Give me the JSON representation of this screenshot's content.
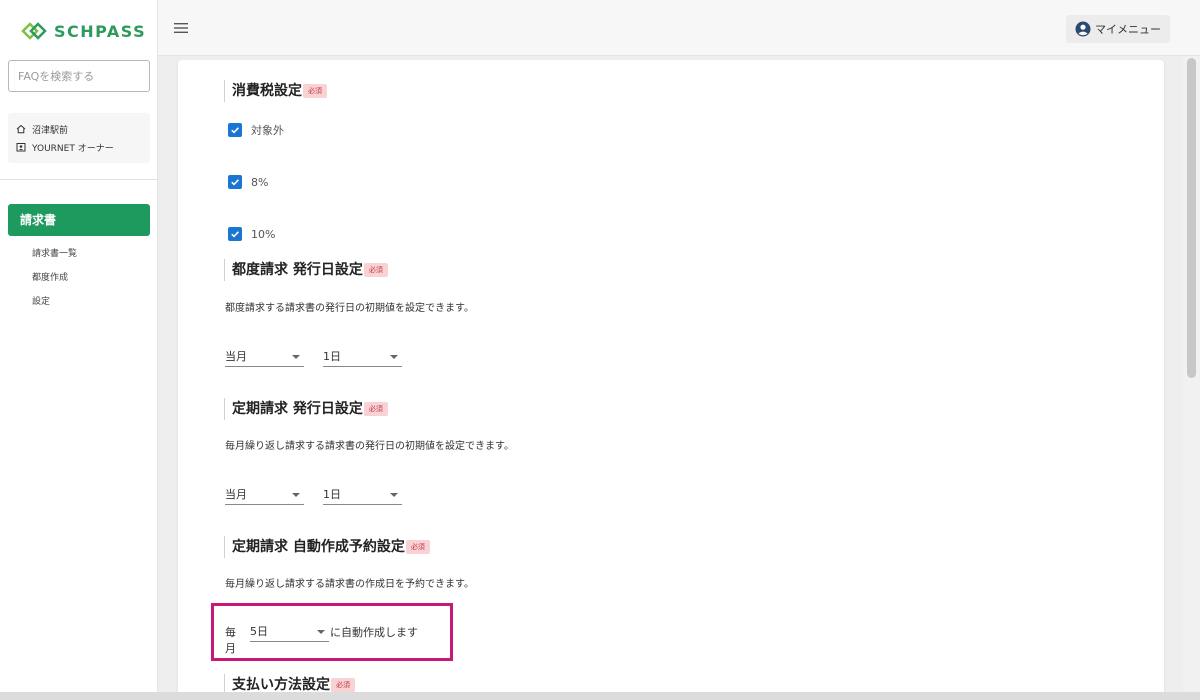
{
  "sidebar": {
    "logo_text": "SCHPASS",
    "search_placeholder": "FAQを検索する",
    "account": {
      "location": "沼津駅前",
      "user": "YOURNET オーナー"
    },
    "nav": {
      "active_label": "請求書",
      "sub_items": [
        "請求書一覧",
        "都度作成",
        "設定"
      ]
    }
  },
  "header": {
    "mymenu_label": "マイメニュー"
  },
  "main": {
    "tax": {
      "title": "消費税設定",
      "required": "必須",
      "options": [
        "対象外",
        "8%",
        "10%"
      ]
    },
    "adhoc": {
      "title": "都度請求 発行日設定",
      "required": "必須",
      "description": "都度請求する請求書の発行日の初期値を設定できます。",
      "month": "当月",
      "day": "1日"
    },
    "recurring": {
      "title": "定期請求 発行日設定",
      "required": "必須",
      "description": "毎月繰り返し請求する請求書の発行日の初期値を設定できます。",
      "month": "当月",
      "day": "1日"
    },
    "auto": {
      "title": "定期請求 自動作成予約設定",
      "required": "必須",
      "description": "毎月繰り返し請求する請求書の作成日を予約できます。",
      "prefix": "毎月",
      "day": "5日",
      "suffix": "に自動作成します"
    },
    "payment": {
      "title": "支払い方法設定",
      "required": "必須"
    }
  },
  "colors": {
    "brand_green": "#1e9a5f",
    "checkbox_blue": "#1976d2",
    "required_bg": "#f9d2d4",
    "highlight_border": "#c8197a"
  }
}
